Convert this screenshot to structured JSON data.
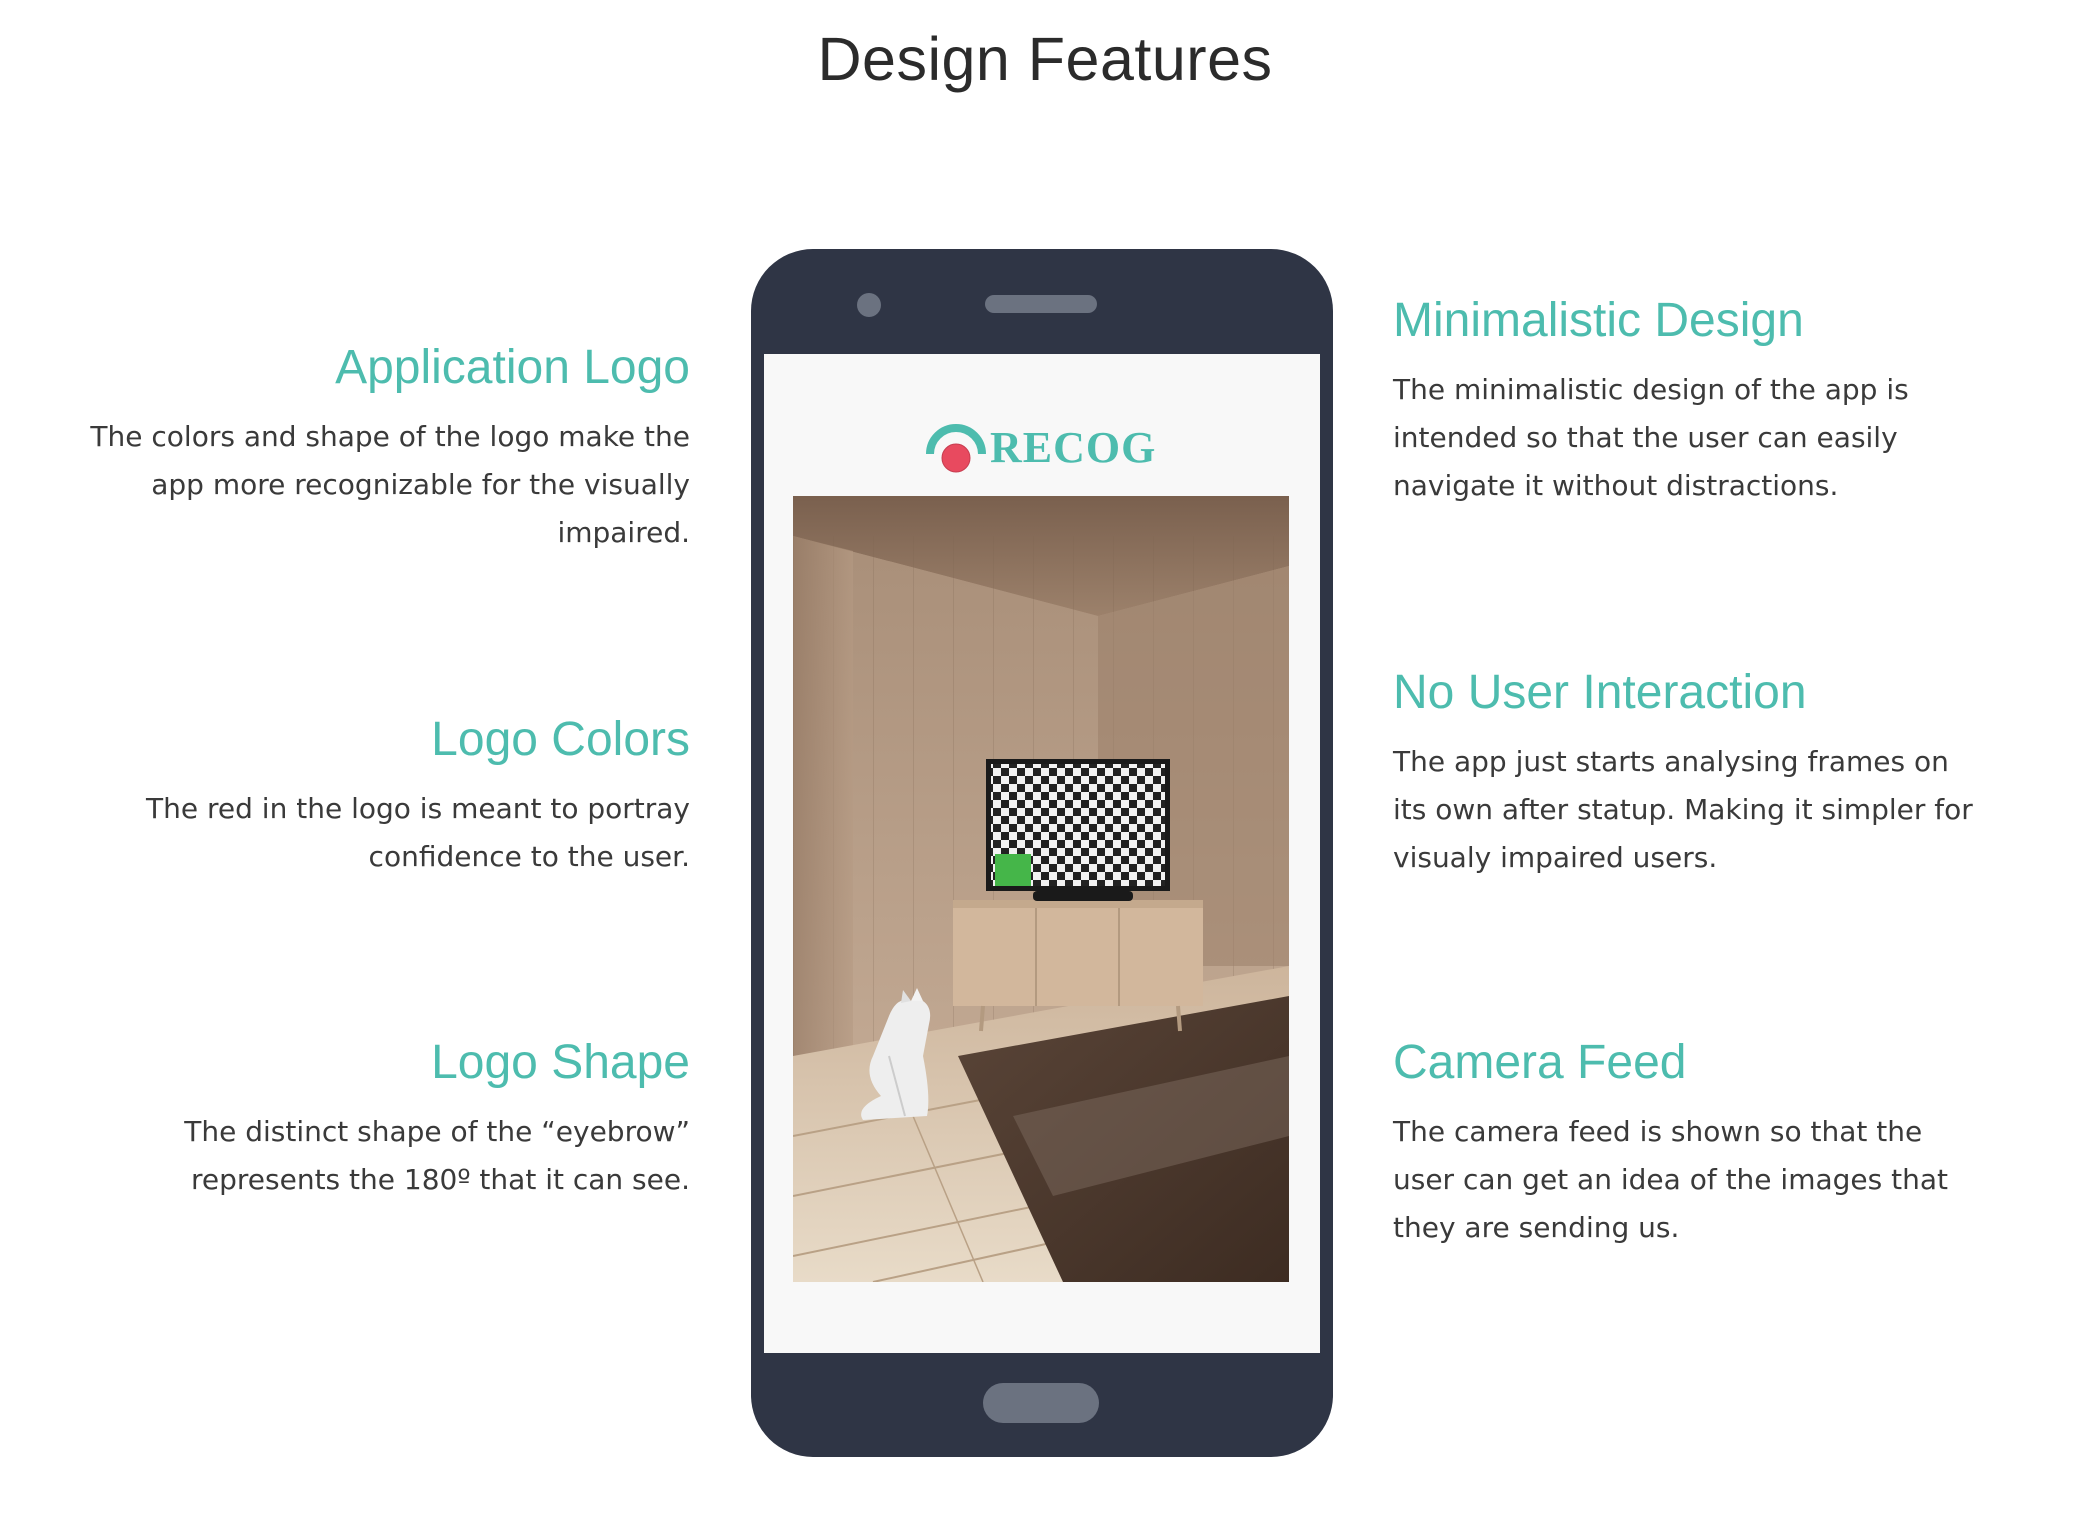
{
  "page": {
    "title": "Design Features"
  },
  "features_left": [
    {
      "title": "Application Logo",
      "description": "The colors and shape of the logo make the app more recognizable for the visually impaired."
    },
    {
      "title": "Logo Colors",
      "description": "The red in the logo is meant to portray confidence to the user."
    },
    {
      "title": "Logo Shape",
      "description": "The distinct shape of the “eyebrow” represents the 180º that it can see."
    }
  ],
  "features_right": [
    {
      "title": "Minimalistic Design",
      "description": "The minimalistic design of the app is intended so that the user can easily navigate it without distractions."
    },
    {
      "title": "No User Interaction",
      "description": "The app just starts analysing frames on its own after statup. Making it simpler for visualy impaired users."
    },
    {
      "title": "Camera Feed",
      "description": "The camera feed is shown so that the user can get an idea of the images that they are sending us."
    }
  ],
  "phone": {
    "app_name": "RECOG",
    "icons": [
      "camera-icon",
      "speaker-icon",
      "home-button-icon",
      "recog-eye-logo-icon"
    ]
  },
  "colors": {
    "accent": "#4dbcae",
    "logo_red": "#e84a5f",
    "phone_body": "#2f3545",
    "phone_detail": "#6b7280",
    "screen_bg": "#f8f8f8"
  }
}
